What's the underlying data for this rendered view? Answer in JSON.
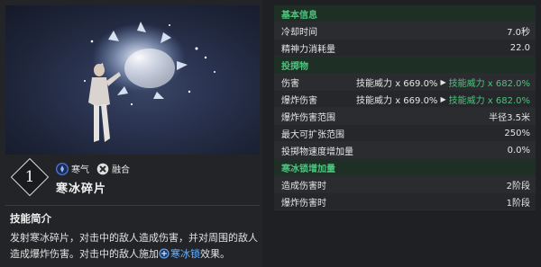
{
  "skill": {
    "level": "1",
    "name": "寒冰碎片",
    "tags": [
      {
        "label": "寒气",
        "icon": "frost-icon",
        "color": "#3f6fd8"
      },
      {
        "label": "融合",
        "icon": "fusion-icon",
        "color": "#d9d9d9"
      }
    ]
  },
  "description": {
    "title": "技能简介",
    "text_1": "发射寒冰碎片，对击中的敌人造成伤害，并对周围的敌人造成爆炸伤害。对击中的敌人施加",
    "keyword": "寒冰锁",
    "text_2": "效果。"
  },
  "stats": {
    "section_basic": "基本信息",
    "cooldown_label": "冷却时间",
    "cooldown_value": "7.0秒",
    "mp_label": "精神力消耗量",
    "mp_value": "22.0",
    "section_projectile": "投掷物",
    "damage_label": "伤害",
    "damage_old": "技能威力 x 669.0%",
    "damage_new": "技能威力 x 682.0%",
    "explosion_label": "爆炸伤害",
    "explosion_old": "技能威力 x 669.0%",
    "explosion_new": "技能威力 x 682.0%",
    "explosion_range_label": "爆炸伤害范围",
    "explosion_range_value": "半径3.5米",
    "max_expand_label": "最大可扩张范围",
    "max_expand_value": "250%",
    "proj_speed_label": "投掷物速度增加量",
    "proj_speed_value": "0.0%",
    "section_frostlock": "寒冰锁增加量",
    "dmg_stage_label": "造成伤害时",
    "dmg_stage_value": "2阶段",
    "explode_stage_label": "爆炸伤害时",
    "explode_stage_value": "1阶段"
  },
  "colors": {
    "accent_green": "#4fc27e",
    "keyword_blue": "#6fb4ff"
  }
}
